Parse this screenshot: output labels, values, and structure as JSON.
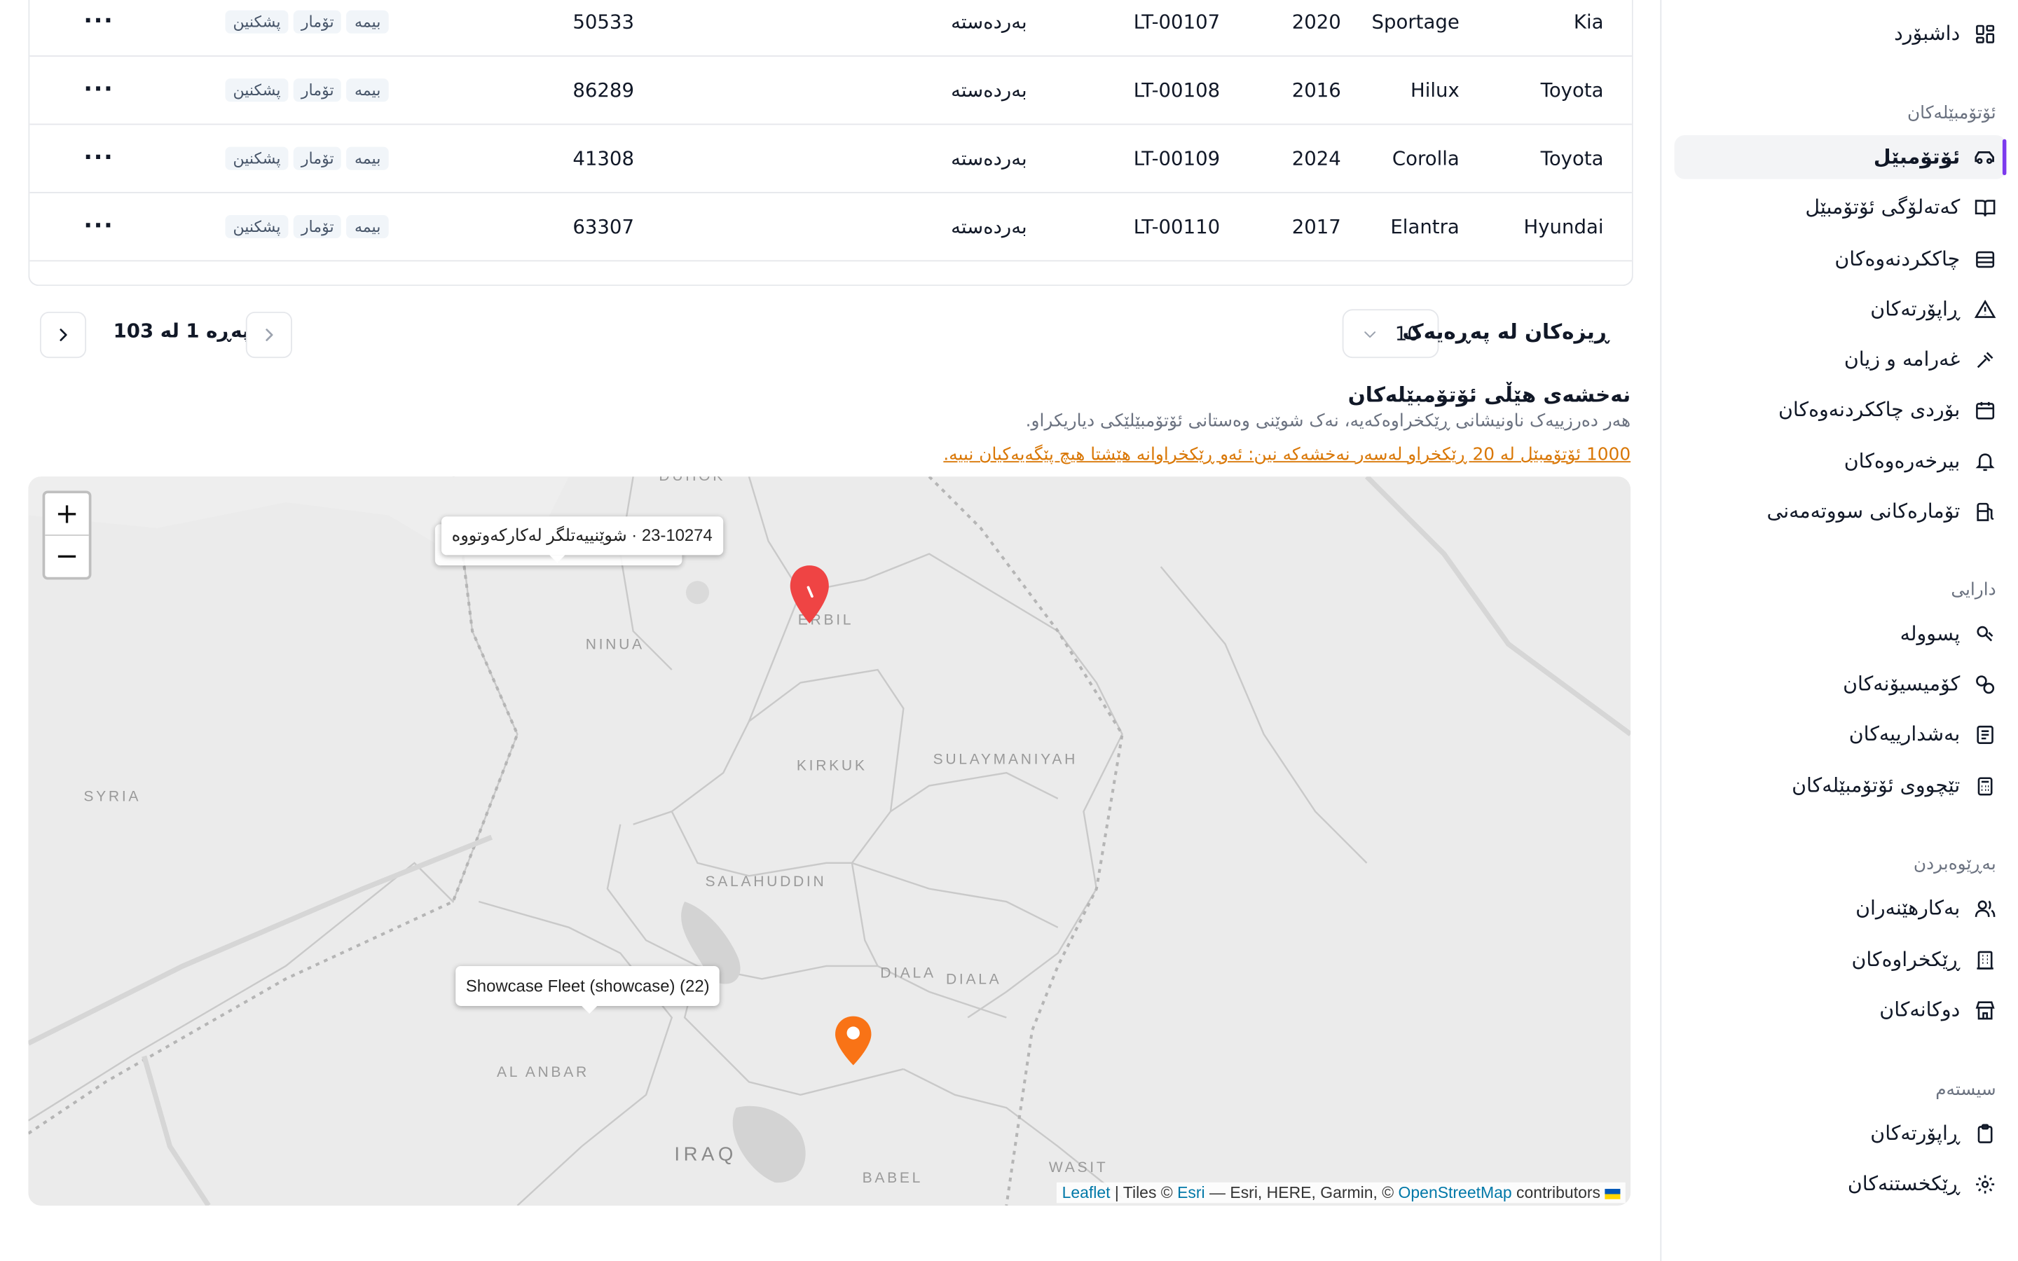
{
  "table": {
    "rows": [
      {
        "make": "Kia",
        "model": "Sportage",
        "year": "2020",
        "plate": "LT-00107",
        "status": "بەردەستە",
        "mileage": "50533",
        "tags": [
          "بیمە",
          "تۆمار",
          "پشکنین"
        ]
      },
      {
        "make": "Toyota",
        "model": "Hilux",
        "year": "2016",
        "plate": "LT-00108",
        "status": "بەردەستە",
        "mileage": "86289",
        "tags": [
          "بیمە",
          "تۆمار",
          "پشکنین"
        ]
      },
      {
        "make": "Toyota",
        "model": "Corolla",
        "year": "2024",
        "plate": "LT-00109",
        "status": "بەردەستە",
        "mileage": "41308",
        "tags": [
          "بیمە",
          "تۆمار",
          "پشکنین"
        ]
      },
      {
        "make": "Hyundai",
        "model": "Elantra",
        "year": "2017",
        "plate": "LT-00110",
        "status": "بەردەستە",
        "mileage": "63307",
        "tags": [
          "بیمە",
          "تۆمار",
          "پشکنین"
        ]
      }
    ],
    "row_action_icon": "more-horizontal-icon"
  },
  "pagination": {
    "page_text": "پەڕە 1 لە 103",
    "per_page_label": "ڕیزەکان لە پەڕەیەک",
    "per_page_value": "10"
  },
  "map_section": {
    "title": "نەخشەی هێڵی ئۆتۆمبێلەکان",
    "subtitle": "هەر دەرزییەک ناونیشانی ڕێکخراوەکەیە، نەک شوێنی وەستانی ئۆتۆمبێلێکی دیاریکراو.",
    "warning": "1000 ئۆتۆمبێل لە 20 ڕێکخراو لەسەر نەخشەکە نین: ئەو ڕێکخراوانە هێشتا هیچ پێگەیەکیان نییە.",
    "popup_1": "23-10274 · شوێنییەتلگر لەکارکەوتووە",
    "popup_2": "Showcase Fleet (showcase) (22)",
    "zoom_in": "+",
    "zoom_out": "−",
    "places": [
      "DUHOK",
      "ERBIL",
      "NINUA",
      "SYRIA",
      "KIRKUK",
      "SULAYMANIYAH",
      "SALAHUDDIN",
      "DIALA",
      "DIALA",
      "AL ANBAR",
      "IRAQ",
      "BABEL",
      "WASIT"
    ],
    "attribution": {
      "leaflet": "Leaflet",
      "tiles_prefix": " | Tiles © ",
      "esri": "Esri",
      "middle": " — Esri, HERE, Garmin, © ",
      "osm": "OpenStreetMap",
      "suffix": " contributors"
    },
    "marker_colors": {
      "red": "#ef4444",
      "orange": "#f97316"
    }
  },
  "sidebar": {
    "dashboard": "داشبۆرد",
    "section_vehicles": "ئۆتۆمبێلەکان",
    "vehicles": "ئۆتۆمبێل",
    "catalog": "کەتەلۆگی ئۆتۆمبێل",
    "maintenance": "چاککردنەوەکان",
    "reports": "ڕاپۆرتەکان",
    "fines": "غەرامە و زیان",
    "maintenance_board": "بۆردی چاککردنەوەکان",
    "reminders": "بیرخەرەوەکان",
    "fuel": "تۆمارەکانی سووتەمەنی",
    "section_finance": "دارایی",
    "receipts": "پسوولە",
    "commissions": "کۆمیسیۆنەکان",
    "shares": "بەشدارییەکان",
    "vehicle_costs": "تێچووی ئۆتۆمبێلەکان",
    "section_management": "بەڕێوەبردن",
    "users": "بەکارهێنەران",
    "organizations": "ڕێکخراوەکان",
    "shops": "دوکانەکان",
    "section_system": "سیستەم",
    "system_reports": "ڕاپۆرتەکان",
    "settings": "ڕێکخستنەکان",
    "accent_color": "#7c3aed"
  }
}
